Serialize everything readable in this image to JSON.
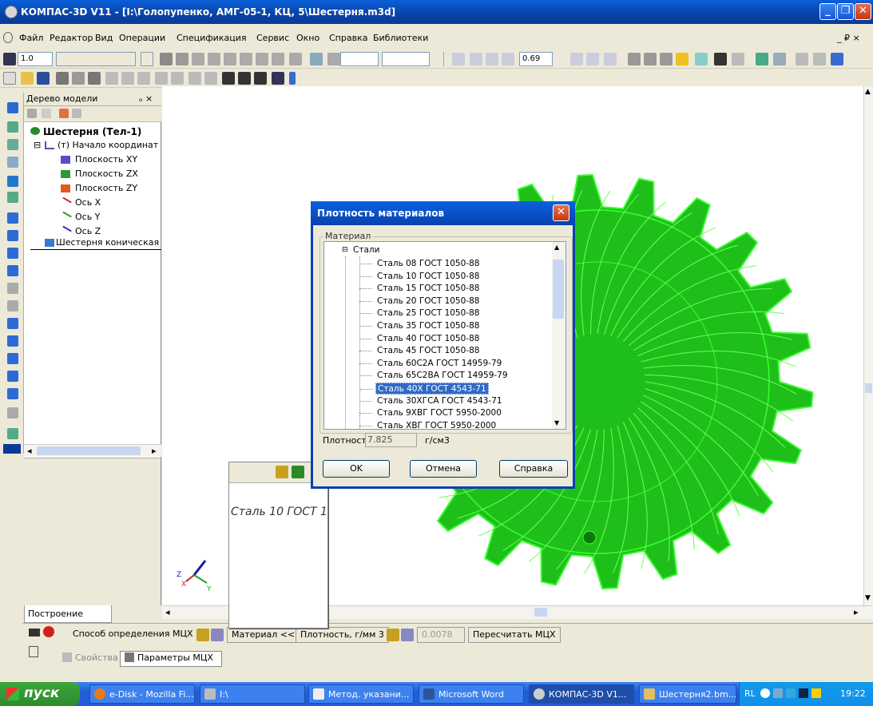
{
  "window": {
    "title": "КОМПАС-3D V11 - [I:\\Голопупенко, АМГ-05-1, КЦ, 5\\Шестерня.m3d]",
    "minimize": "_",
    "maximize": "❐",
    "close": "✕"
  },
  "menu": {
    "items": [
      "Файл",
      "Редактор",
      "Вид",
      "Операции",
      "Спецификация",
      "Сервис",
      "Окно",
      "Справка",
      "Библиотеки"
    ],
    "mdi_controls": "_ ₽ ×"
  },
  "toolbar": {
    "step_value": "1.0",
    "zoom_value": "0.69"
  },
  "tree_panel": {
    "title": "Дерево модели",
    "pin": "ₒ ×",
    "items": [
      {
        "label": "Шестерня (Тел-1)"
      },
      {
        "label": "(т) Начало координат"
      },
      {
        "label": "Плоскость XY"
      },
      {
        "label": "Плоскость ZX"
      },
      {
        "label": "Плоскость ZY"
      },
      {
        "label": "Ось X"
      },
      {
        "label": "Ось Y"
      },
      {
        "label": "Ось Z"
      },
      {
        "label": "Шестерня коническая"
      }
    ],
    "tab_label": "Построение"
  },
  "preview": {
    "text": "Сталь 10  ГОСТ 1"
  },
  "dialog": {
    "title": "Плотность материалов",
    "group_label": "Материал",
    "root": "Стали",
    "materials": [
      "Сталь 08  ГОСТ 1050-88",
      "Сталь 10  ГОСТ 1050-88",
      "Сталь 15  ГОСТ 1050-88",
      "Сталь 20  ГОСТ 1050-88",
      "Сталь 25  ГОСТ 1050-88",
      "Сталь 35  ГОСТ 1050-88",
      "Сталь 40  ГОСТ 1050-88",
      "Сталь 45  ГОСТ 1050-88",
      "Сталь 60С2А  ГОСТ 14959-79",
      "Сталь 65С2ВА  ГОСТ 14959-79",
      "Сталь 40Х  ГОСТ 4543-71",
      "Сталь 30ХГСА  ГОСТ 4543-71",
      "Сталь 9ХВГ  ГОСТ 5950-2000",
      "Сталь ХВГ  ГОСТ 5950-2000"
    ],
    "selected_material": "Сталь 40Х  ГОСТ 4543-71",
    "density_label": "Плотность",
    "density_value": "7.825",
    "density_unit": "г/см3",
    "ok": "OK",
    "cancel": "Отмена",
    "help": "Справка"
  },
  "props": {
    "method_label": "Способ определения МЦХ",
    "material_button": "Материал  <<",
    "density_label": "Плотность, г/мм 3",
    "density_value": "0.0078",
    "recalc_button": "Пересчитать МЦХ",
    "tab_properties": "Свойства",
    "tab_params": "Параметры МЦХ"
  },
  "taskbar": {
    "start": "пуск",
    "tasks": [
      "e-Disk - Mozilla Fi...",
      "I:\\",
      "Метод. указани...",
      "Microsoft Word",
      "КОМПАС-3D V1...",
      "Шестерня2.bm..."
    ],
    "lang": "RL",
    "time": "19:22"
  },
  "colors": {
    "gear_fill": "#1fbf1a",
    "gear_edges": "#39ff30",
    "xp_blue": "#0842b0",
    "selection": "#316ac5"
  }
}
